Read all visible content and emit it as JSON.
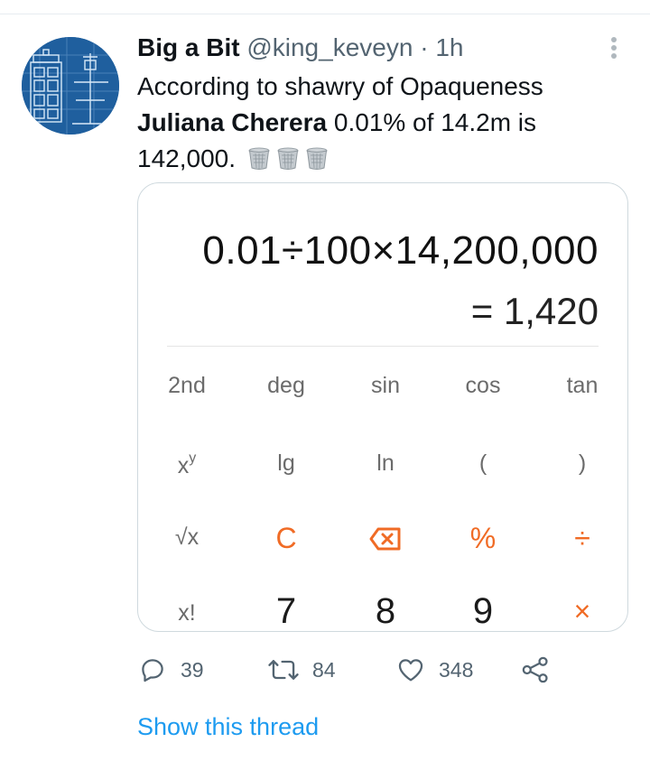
{
  "tweet": {
    "author_name": "Big a Bit",
    "author_handle": "@king_keveyn",
    "separator": "·",
    "time": "1h",
    "text_line1": "According to shawry of Opaqueness",
    "mention": "Juliana Cherera",
    "text_rest": " 0.01% of 14.2m is 142,000.",
    "emoji": "wastebasket-emoji"
  },
  "calculator": {
    "expression": "0.01÷100×14,200,000",
    "result": "= 1,420",
    "rows": [
      [
        "2nd",
        "deg",
        "sin",
        "cos",
        "tan"
      ],
      [
        "x^y",
        "lg",
        "ln",
        "(",
        ")"
      ],
      [
        "√x",
        "C",
        "⌫",
        "%",
        "÷"
      ],
      [
        "x!",
        "7",
        "8",
        "9",
        "×"
      ]
    ],
    "accent_color": "#f06b25"
  },
  "actions": {
    "reply_count": "39",
    "retweet_count": "84",
    "like_count": "348"
  },
  "show_thread_label": "Show this thread",
  "colors": {
    "link": "#1d9bf0",
    "secondary_text": "#536471",
    "border": "#cfd9de"
  }
}
